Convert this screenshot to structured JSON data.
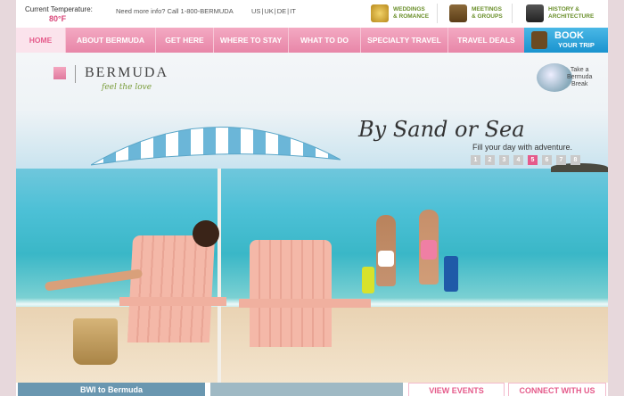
{
  "utility": {
    "temperature_label": "Current Temperature:",
    "temperature_value": "80°F",
    "info": "Need more info? Call 1-800-BERMUDA",
    "languages": [
      "US",
      "UK",
      "DE",
      "IT"
    ],
    "links": [
      {
        "label": "WEDDINGS\n& ROMANCE",
        "icon": "rings-icon"
      },
      {
        "label": "MEETINGS\n& GROUPS",
        "icon": "briefcase-icon"
      },
      {
        "label": "HISTORY &\nARCHITECTURE",
        "icon": "cannon-icon"
      }
    ]
  },
  "nav": {
    "items": [
      "HOME",
      "ABOUT BERMUDA",
      "GET HERE",
      "WHERE TO STAY",
      "WHAT TO DO",
      "SPECIALTY TRAVEL",
      "TRAVEL DEALS"
    ],
    "active": "HOME",
    "book_line1": "BOOK",
    "book_line2": "YOUR TRIP"
  },
  "hero": {
    "logo_text": "BERMUDA",
    "tagline": "feel the love",
    "break_label": "Take a\nBermuda\nBreak",
    "headline": "By Sand or Sea",
    "subheadline": "Fill your day with adventure.",
    "slides": [
      "1",
      "2",
      "3",
      "4",
      "5",
      "6",
      "7",
      "8"
    ],
    "active_slide": "5"
  },
  "bottom": {
    "promo_left": "BWI to Bermuda",
    "events": "VIEW EVENTS CALENDAR",
    "connect": "CONNECT WITH US"
  },
  "colors": {
    "accent_pink": "#e55b8b",
    "nav_pink": "#f3a9c2",
    "book_blue": "#1a93cf",
    "tag_green": "#7a9c3a"
  }
}
